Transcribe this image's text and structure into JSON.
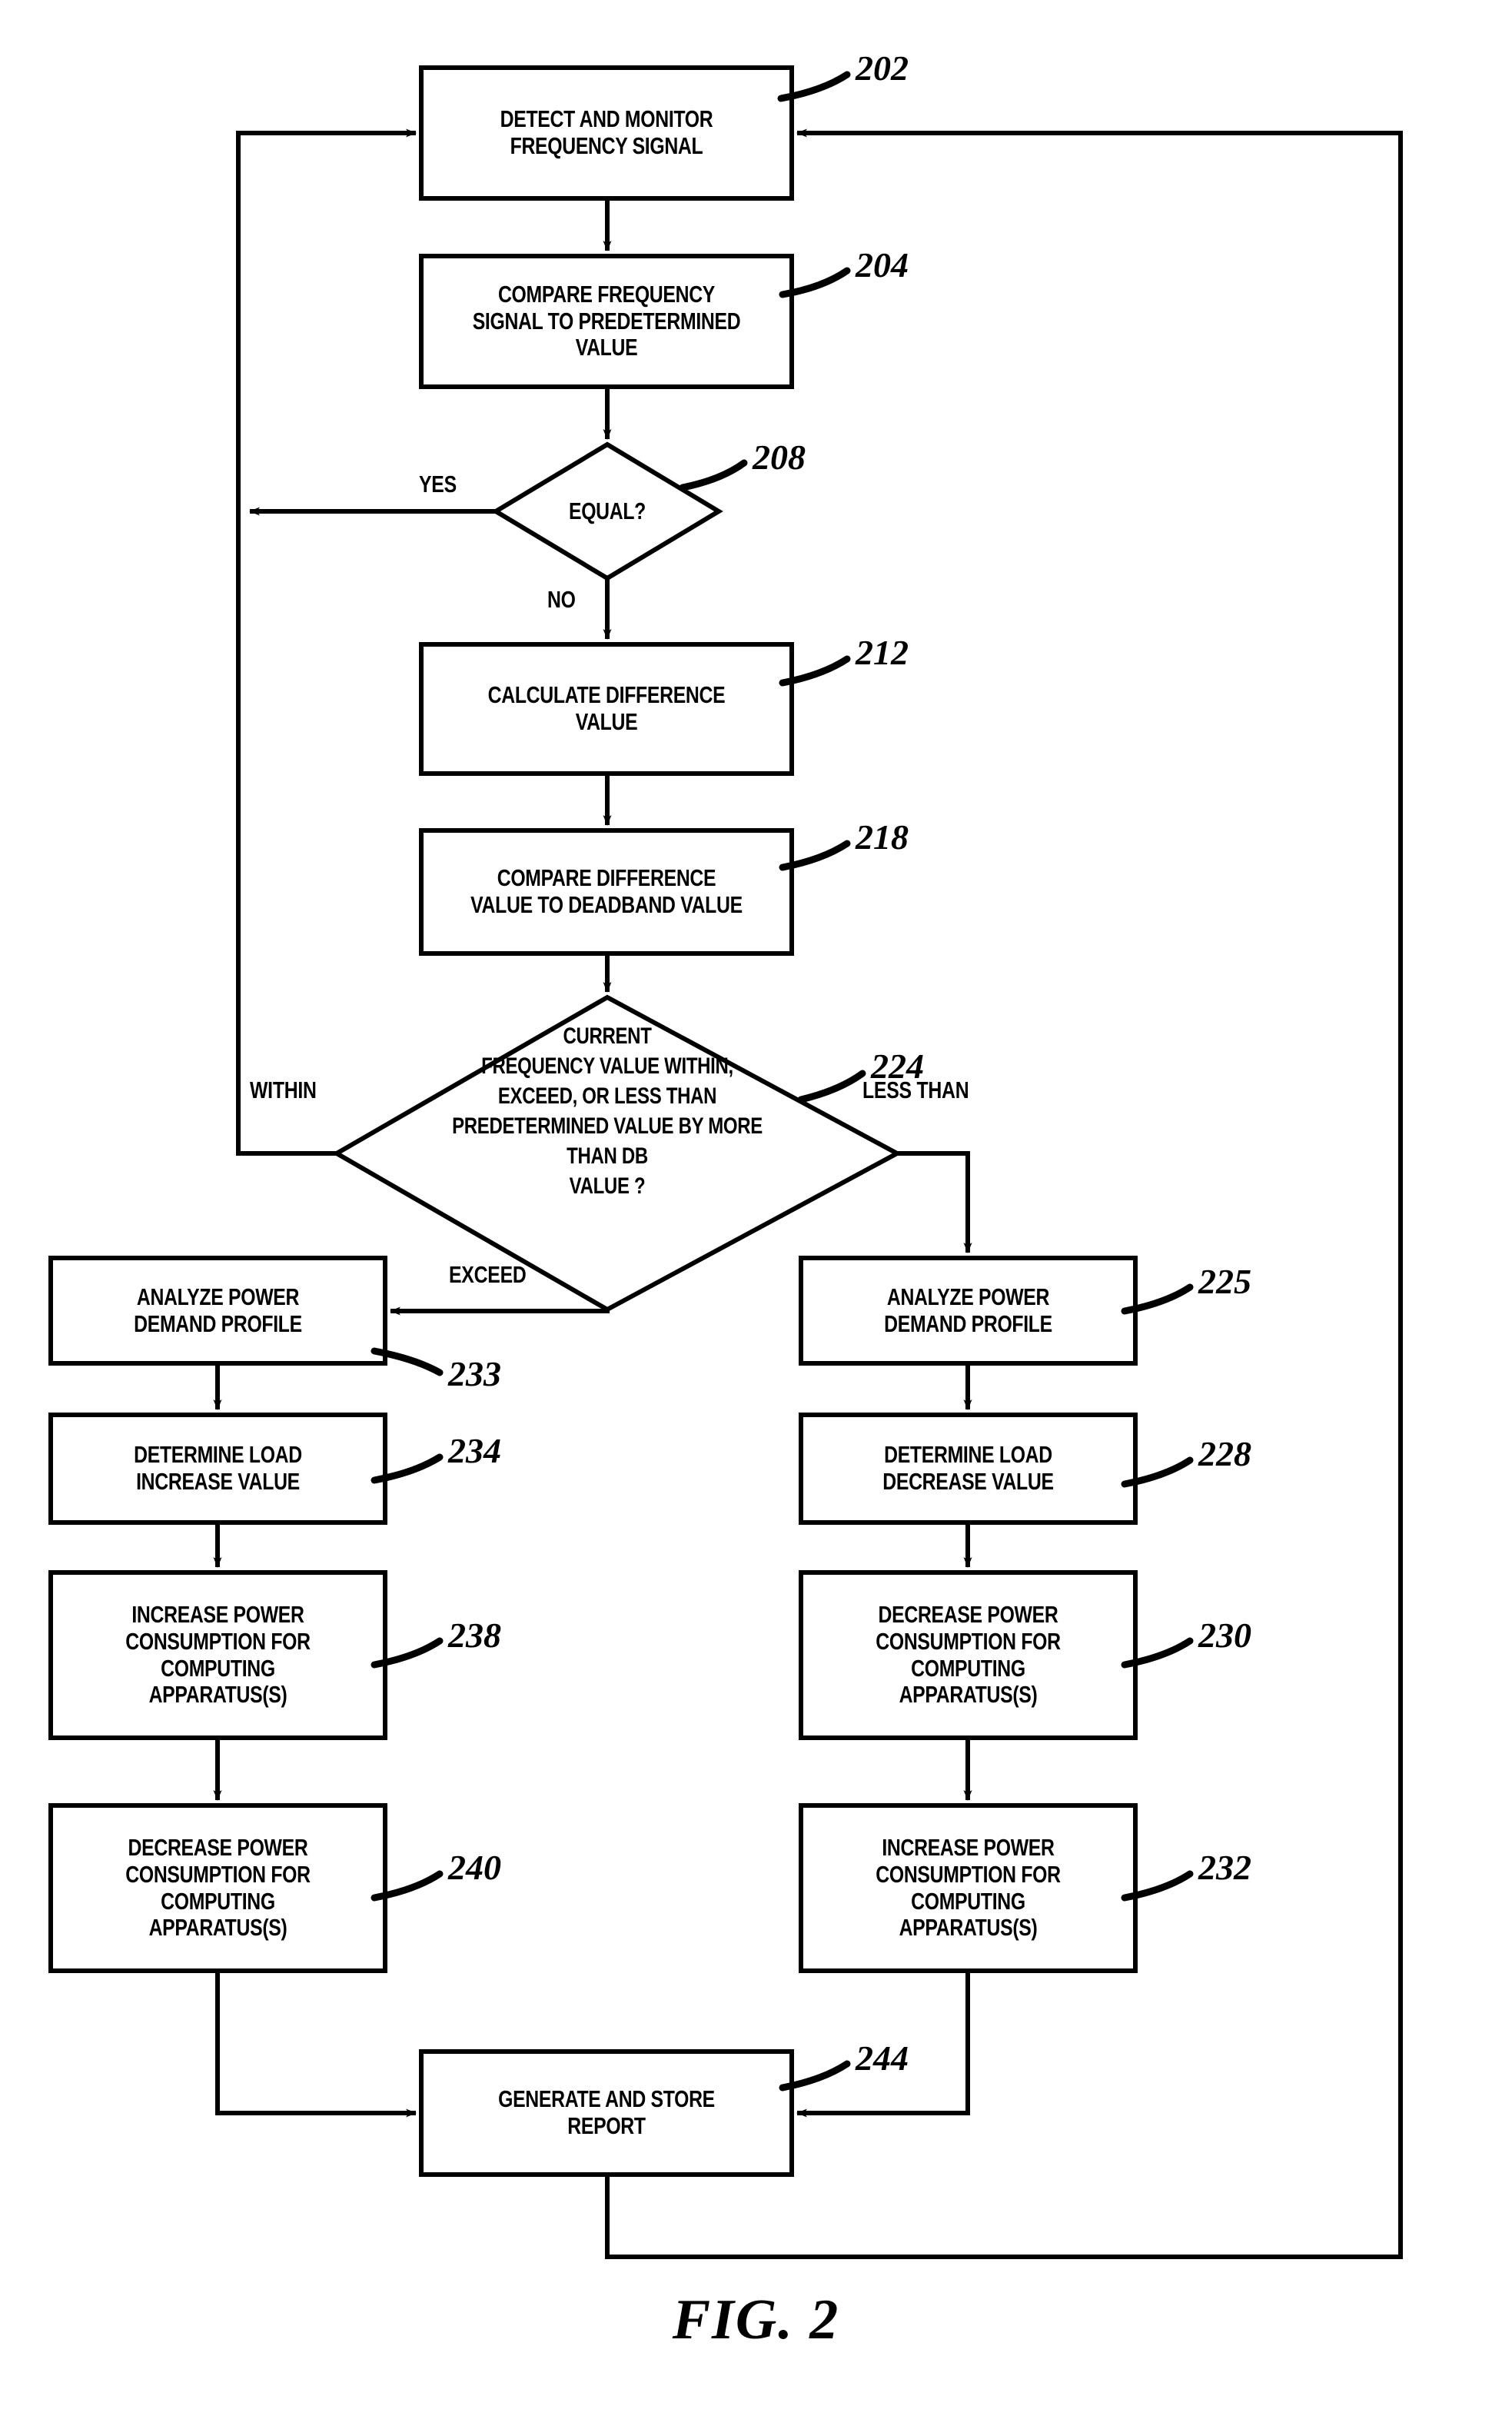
{
  "figure": {
    "caption": "FIG.  2",
    "nodes": [
      {
        "id": "202",
        "ref": "202",
        "shape": "process",
        "label": "DETECT AND MONITOR\nFREQUENCY SIGNAL"
      },
      {
        "id": "204",
        "ref": "204",
        "shape": "process",
        "label": "COMPARE FREQUENCY\nSIGNAL TO PREDETERMINED\nVALUE"
      },
      {
        "id": "208",
        "ref": "208",
        "shape": "decision",
        "label": "EQUAL?"
      },
      {
        "id": "212",
        "ref": "212",
        "shape": "process",
        "label": "CALCULATE DIFFERENCE\nVALUE"
      },
      {
        "id": "218",
        "ref": "218",
        "shape": "process",
        "label": "COMPARE DIFFERENCE\nVALUE TO DEADBAND VALUE"
      },
      {
        "id": "224",
        "ref": "224",
        "shape": "decision",
        "label": "CURRENT\nFREQUENCY VALUE WITHIN,\nEXCEED, OR LESS THAN\nPREDETERMINED VALUE BY MORE\nTHAN DB\nVALUE ?"
      },
      {
        "id": "233",
        "ref": "233",
        "shape": "process",
        "label": "ANALYZE POWER\nDEMAND PROFILE"
      },
      {
        "id": "234",
        "ref": "234",
        "shape": "process",
        "label": "DETERMINE LOAD\nINCREASE VALUE"
      },
      {
        "id": "238",
        "ref": "238",
        "shape": "process",
        "label": "INCREASE POWER\nCONSUMPTION FOR\nCOMPUTING\nAPPARATUS(S)"
      },
      {
        "id": "240",
        "ref": "240",
        "shape": "process",
        "label": "DECREASE POWER\nCONSUMPTION FOR\nCOMPUTING\nAPPARATUS(S)"
      },
      {
        "id": "225",
        "ref": "225",
        "shape": "process",
        "label": "ANALYZE POWER\nDEMAND PROFILE"
      },
      {
        "id": "228",
        "ref": "228",
        "shape": "process",
        "label": "DETERMINE LOAD\nDECREASE VALUE"
      },
      {
        "id": "230",
        "ref": "230",
        "shape": "process",
        "label": "DECREASE POWER\nCONSUMPTION FOR\nCOMPUTING\nAPPARATUS(S)"
      },
      {
        "id": "232",
        "ref": "232",
        "shape": "process",
        "label": "INCREASE POWER\nCONSUMPTION FOR\nCOMPUTING\nAPPARATUS(S)"
      },
      {
        "id": "244",
        "ref": "244",
        "shape": "process",
        "label": "GENERATE AND STORE\nREPORT"
      }
    ],
    "edge_labels": {
      "yes": "YES",
      "no": "NO",
      "within": "WITHIN",
      "exceed": "EXCEED",
      "less_than": "LESS THAN"
    },
    "style": {
      "line_color": "#000000",
      "fill_color": "#ffffff",
      "text_color": "#000000"
    }
  }
}
